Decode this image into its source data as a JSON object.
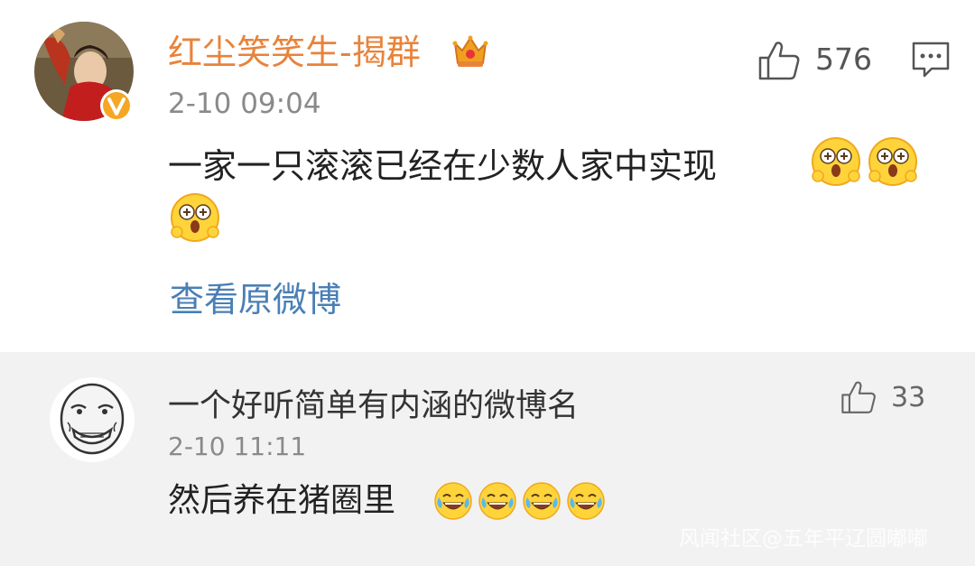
{
  "main_comment": {
    "username": "红尘笑笑生-揭群",
    "timestamp": "2-10 09:04",
    "text": "一家一只滚滚已经在少数人家中实现",
    "like_count": "576",
    "view_original_label": "查看原微博",
    "emoji": "surprised-emoji",
    "emoji_count": 3,
    "accent_color": "#e8833a",
    "link_color": "#4a7fb5"
  },
  "reply": {
    "username": "一个好听简单有内涵的微博名",
    "timestamp": "2-10 11:11",
    "text": "然后养在猪圈里",
    "like_count": "33",
    "emoji": "laughing-crying-emoji",
    "emoji_count": 4
  },
  "watermark": "风闻社区@五年平辽圆嘟嘟"
}
